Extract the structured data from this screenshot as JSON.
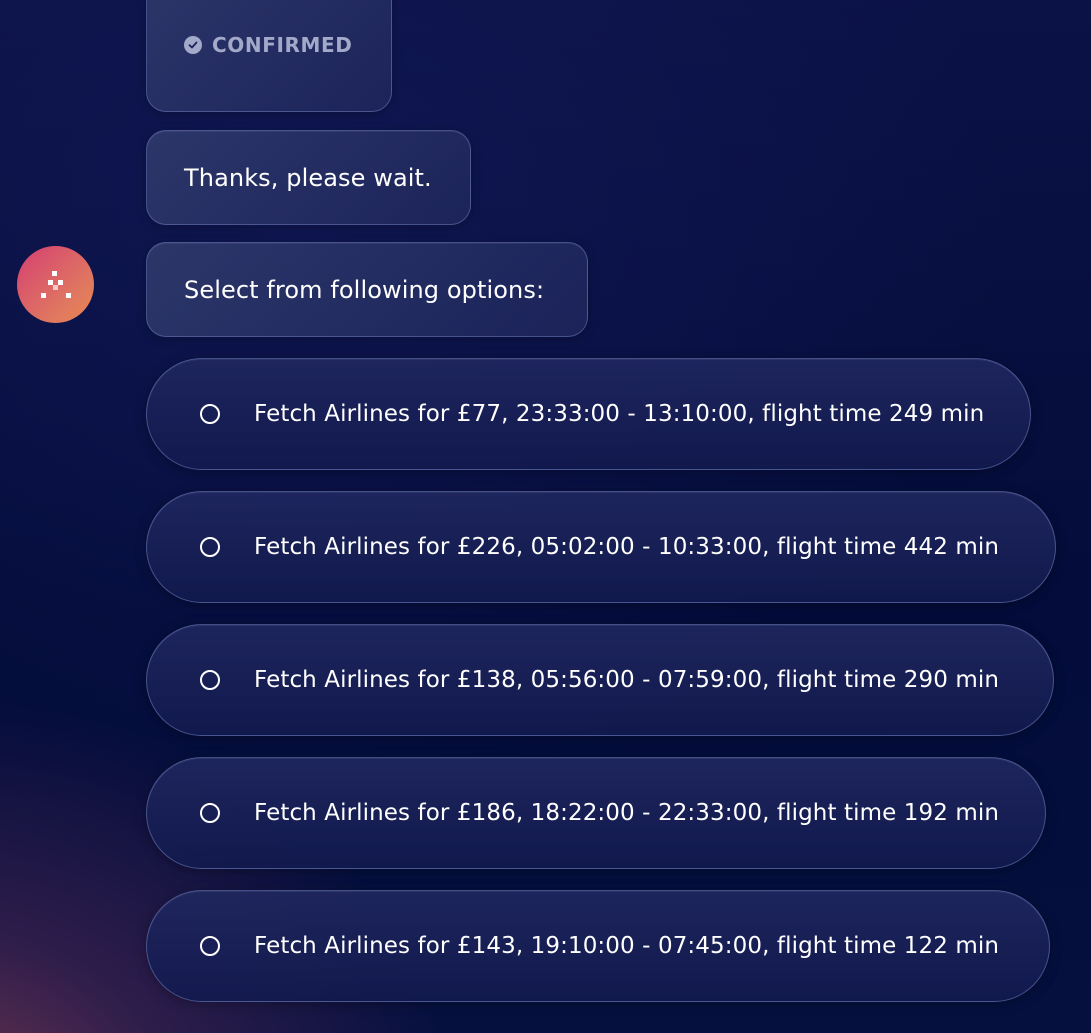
{
  "messages": {
    "confirmed_status": "CONFIRMED",
    "wait_text": "Thanks, please wait.",
    "select_prompt": "Select from following options:"
  },
  "options": [
    {
      "label": "Fetch Airlines for £77, 23:33:00 - 13:10:00, flight time 249 min"
    },
    {
      "label": "Fetch Airlines for £226, 05:02:00 - 10:33:00, flight time 442 min"
    },
    {
      "label": "Fetch Airlines for £138, 05:56:00 - 07:59:00, flight time 290 min"
    },
    {
      "label": "Fetch Airlines for £186, 18:22:00 - 22:33:00, flight time 192 min"
    },
    {
      "label": "Fetch Airlines for £143, 19:10:00 - 07:45:00, flight time 122 min"
    }
  ],
  "colors": {
    "background": "#030c3a",
    "avatar_gradient_start": "#d43f72",
    "avatar_gradient_end": "#e8874f",
    "confirmed_text": "#a3a9c9"
  },
  "icons": {
    "confirmed": "check-circle-icon",
    "avatar": "assistant-logo-icon",
    "option": "radio-unselected-icon"
  }
}
